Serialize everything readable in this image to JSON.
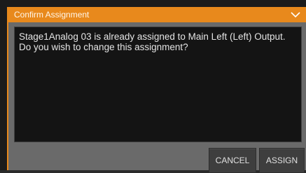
{
  "dialog": {
    "title": "Confirm Assignment",
    "message": "Stage1Analog 03 is already assigned to Main Left (Left) Output. Do you wish to change this assignment?",
    "cancel_label": "CANCEL",
    "assign_label": "ASSIGN",
    "collapse_icon": "chevron-down-icon"
  },
  "colors": {
    "accent": "#e8891c",
    "dialog_body": "#6a6a6a",
    "message_bg": "#141414",
    "button_bg": "#3e3e3e"
  }
}
